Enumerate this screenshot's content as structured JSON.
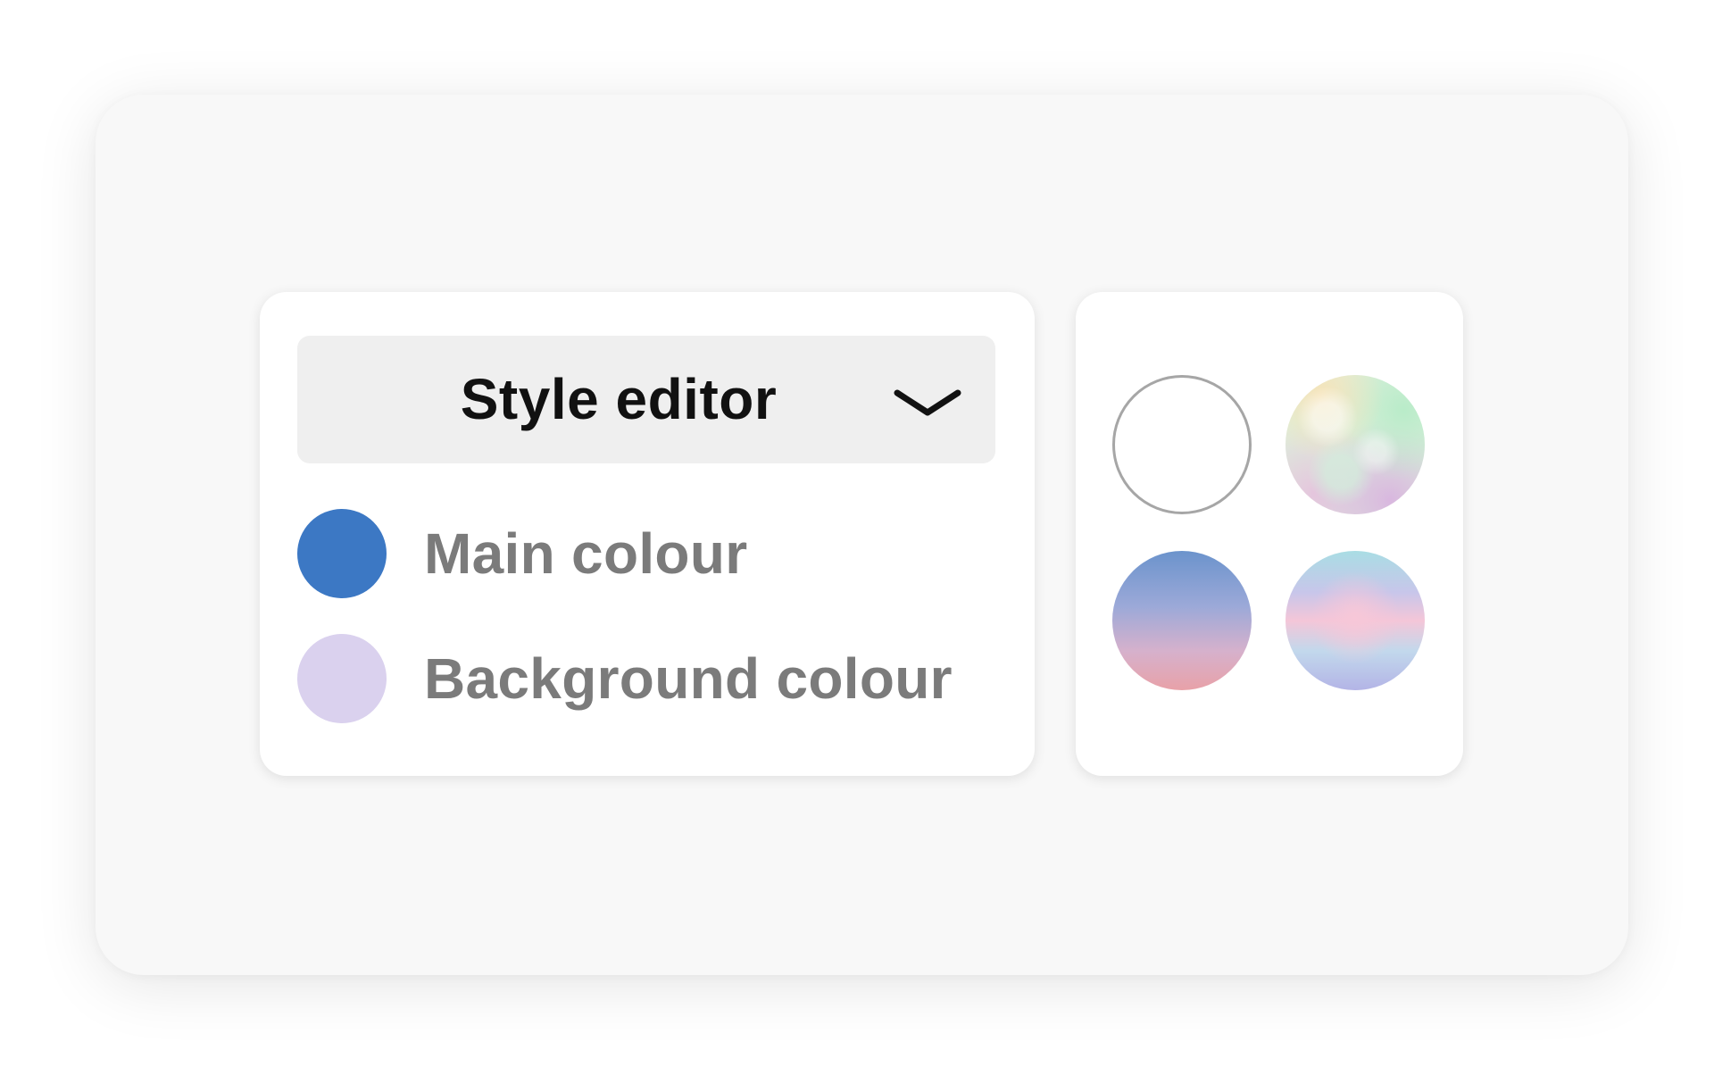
{
  "style_editor": {
    "dropdown_label": "Style editor",
    "dropdown_icon": "chevron-down-icon",
    "colors": [
      {
        "label": "Main colour",
        "color": "#3c78c4"
      },
      {
        "label": "Background colour",
        "color": "#dad1ee"
      }
    ]
  },
  "presets": [
    {
      "name": "white",
      "description": "plain white swatch"
    },
    {
      "name": "pastel-texture"
    },
    {
      "name": "blue-pink-gradient"
    },
    {
      "name": "holographic-gradient"
    }
  ]
}
